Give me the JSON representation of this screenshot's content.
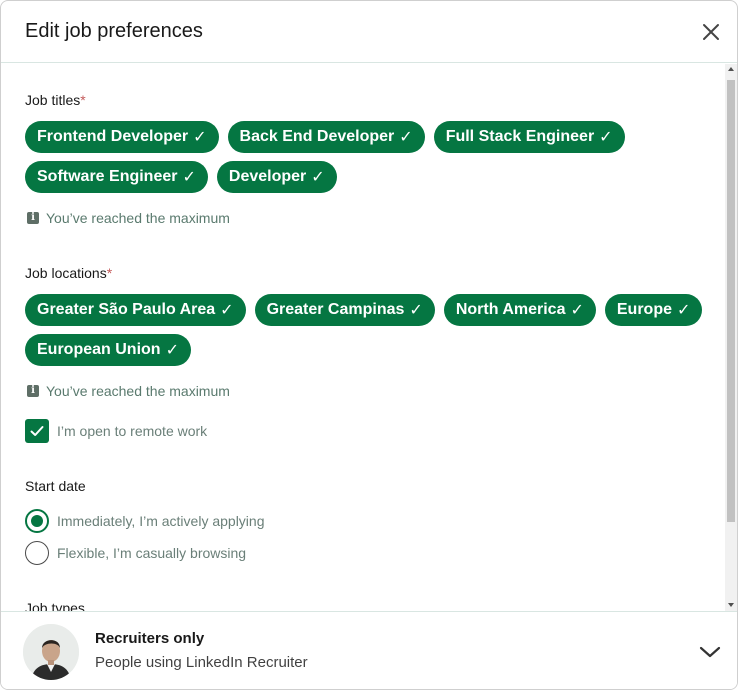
{
  "modal": {
    "title": "Edit job preferences",
    "close_icon": "close-icon"
  },
  "job_titles": {
    "label": "Job titles",
    "required_mark": "*",
    "items": [
      {
        "label": "Frontend Developer",
        "check": "✓"
      },
      {
        "label": "Back End Developer",
        "check": "✓"
      },
      {
        "label": "Full Stack Engineer",
        "check": "✓"
      },
      {
        "label": "Software Engineer",
        "check": "✓"
      },
      {
        "label": "Developer",
        "check": "✓"
      }
    ],
    "hint": "You’ve reached the maximum",
    "hint_icon": "i"
  },
  "job_locations": {
    "label": "Job locations",
    "required_mark": "*",
    "items": [
      {
        "label": "Greater São Paulo Area",
        "check": "✓"
      },
      {
        "label": "Greater Campinas",
        "check": "✓"
      },
      {
        "label": "North America",
        "check": "✓"
      },
      {
        "label": "Europe",
        "check": "✓"
      },
      {
        "label": "European Union",
        "check": "✓"
      }
    ],
    "hint": "You’ve reached the maximum",
    "hint_icon": "i",
    "remote_label": "I’m open to remote work",
    "remote_checked": true
  },
  "start_date": {
    "label": "Start date",
    "options": [
      {
        "label": "Immediately, I’m actively applying",
        "selected": true
      },
      {
        "label": "Flexible, I’m casually browsing",
        "selected": false
      }
    ]
  },
  "job_types": {
    "label": "Job types"
  },
  "visibility": {
    "title": "Recruiters only",
    "description": "People using LinkedIn Recruiter",
    "chevron_icon": "chevron-down-icon"
  },
  "colors": {
    "accent": "#057642",
    "hint": "#5a7a6e",
    "divider": "#d9e6e2"
  }
}
